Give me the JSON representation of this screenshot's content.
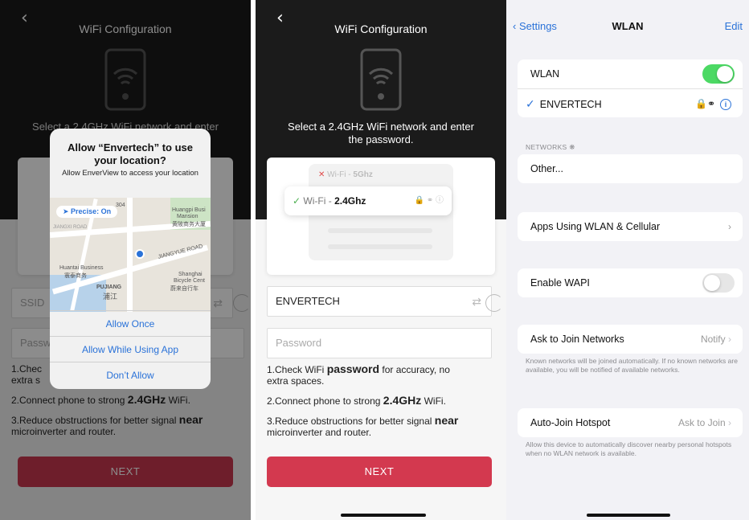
{
  "panel1": {
    "title": "WiFi Configuration",
    "hero_text": "Select a 2.4GHz WiFi network and enter",
    "ssid_placeholder": "SSID",
    "password_placeholder": "Passw",
    "tip1_a": "1.Chec",
    "tip1_b": "extra s",
    "tip2_a": "2.Connect phone to strong ",
    "tip2_b": "2.4GHz",
    "tip2_c": " WiFi.",
    "tip3_a": "3.Reduce obstructions for better signal ",
    "tip3_b": "near",
    "tip3_c": "microinverter and router.",
    "next_label": "NEXT",
    "alert": {
      "title": "Allow “Envertech” to use your location?",
      "message": "Allow EnverView to access your location",
      "precise": "Precise: On",
      "map_labels": [
        "Huangpi Busi",
        "Mansion",
        "黄陂商务大厦",
        "JIANGXI ROAD",
        "JIANGYUE ROAD",
        "Huantai Business",
        "寰泰商务",
        "PUJIANG",
        "浦江",
        "Shanghai",
        "Bicycle Cent",
        "蔚来自行车",
        "304"
      ],
      "allow_once": "Allow Once",
      "allow_while_using": "Allow While Using App",
      "dont_allow": "Don’t Allow"
    }
  },
  "panel2": {
    "title": "WiFi Configuration",
    "hero_text": "Select a 2.4GHz WiFi network and enter the password.",
    "wifi5_prefix": "Wi-Fi - ",
    "wifi5_bold": "5Ghz",
    "wifi24_prefix": "Wi-Fi - ",
    "wifi24_bold": "2.4Ghz",
    "ssid_value": "ENVERTECH",
    "password_placeholder": "Password",
    "tip1_a": "1.Check WiFi ",
    "tip1_b": "password",
    "tip1_c": " for accuracy, no",
    "tip1_d": "extra spaces.",
    "tip2_a": "2.Connect phone to strong ",
    "tip2_b": "2.4GHz",
    "tip2_c": " WiFi.",
    "tip3_a": "3.Reduce obstructions for better signal ",
    "tip3_b": "near",
    "tip3_c": "microinverter and router.",
    "next_label": "NEXT"
  },
  "panel3": {
    "back_label": "Settings",
    "title": "WLAN",
    "edit_label": "Edit",
    "wlan_label": "WLAN",
    "wlan_on": true,
    "connected_network": "ENVERTECH",
    "networks_header": "NETWORKS",
    "other_label": "Other...",
    "apps_label": "Apps Using WLAN & Cellular",
    "wapi_label": "Enable WAPI",
    "wapi_on": false,
    "ask_join_label": "Ask to Join Networks",
    "ask_join_value": "Notify",
    "ask_join_footer": "Known networks will be joined automatically. If no known networks are available, you will be notified of available networks.",
    "auto_join_label": "Auto-Join Hotspot",
    "auto_join_value": "Ask to Join",
    "auto_join_footer": "Allow this device to automatically discover nearby personal hotspots when no WLAN network is available."
  },
  "colors": {
    "accent_blue": "#2a72d8",
    "next_red": "#c8384f",
    "toggle_green": "#4cd964",
    "dark_header": "#1b1b1b"
  }
}
